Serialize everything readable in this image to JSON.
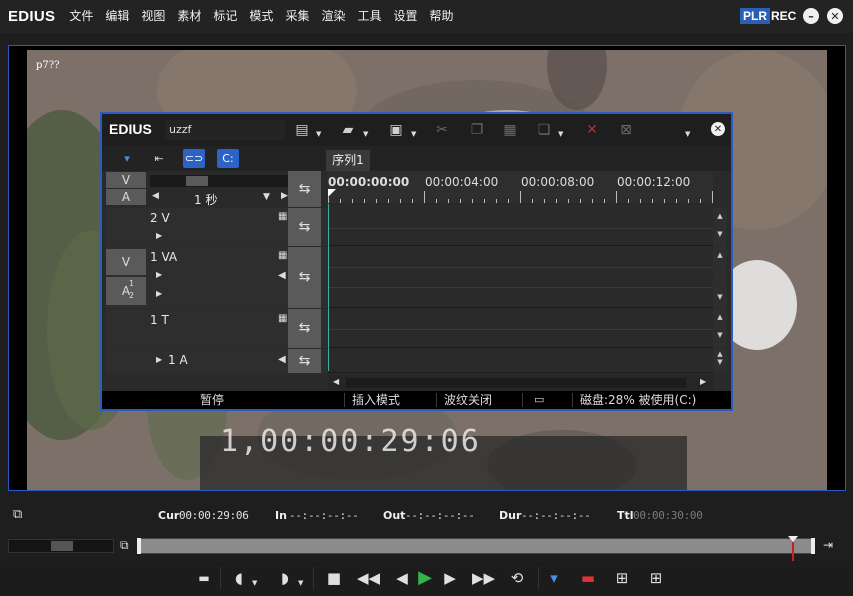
{
  "app": {
    "logo": "EDIUS",
    "menu": [
      "文件",
      "编辑",
      "视图",
      "素材",
      "标记",
      "模式",
      "采集",
      "渲染",
      "工具",
      "设置",
      "帮助"
    ],
    "plr": "PLR",
    "rec": "REC",
    "minimize_glyph": "–",
    "close_glyph": "✕"
  },
  "preview": {
    "video_label": "p7??",
    "ghost_timecode": "1,00:00:29:06"
  },
  "timeline": {
    "logo": "EDIUS",
    "project_name": "uzzf",
    "sequence_tab": "序列1",
    "scale_label": "1 秒",
    "ruler_labels": [
      "00:00:00:00",
      "00:00:04:00",
      "00:00:08:00",
      "00:00:12:00"
    ],
    "tracks": [
      {
        "name": "2 V",
        "type": "V"
      },
      {
        "name": "1 VA",
        "type": "VA",
        "v_box": "V",
        "a_box": "A"
      },
      {
        "name": "1 T",
        "type": "T"
      },
      {
        "name": "1 A",
        "type": "A"
      }
    ],
    "header_boxes": {
      "v": "V",
      "a": "A"
    },
    "status": {
      "pause": "暂停",
      "insert_mode": "插入模式",
      "ripple": "波纹关闭",
      "disk": "磁盘:28% 被使用(C:)"
    }
  },
  "timecode_bar": {
    "cur_label": "Cur",
    "cur_value": "00:00:29:06",
    "in_label": "In",
    "in_value": "--:--:--:--",
    "out_label": "Out",
    "out_value": "--:--:--:--",
    "dur_label": "Dur",
    "dur_value": "--:--:--:--",
    "ttl_label": "Ttl",
    "ttl_value": "00:00:30:00"
  },
  "playback": {
    "position_fraction": 0.967
  },
  "colors": {
    "accent_blue": "#2b5bc0",
    "plr_bg": "#2a5fb4",
    "play_green": "#34b34a",
    "playhead_red": "#c82020",
    "timeline_cursor": "#3ab0a0"
  }
}
